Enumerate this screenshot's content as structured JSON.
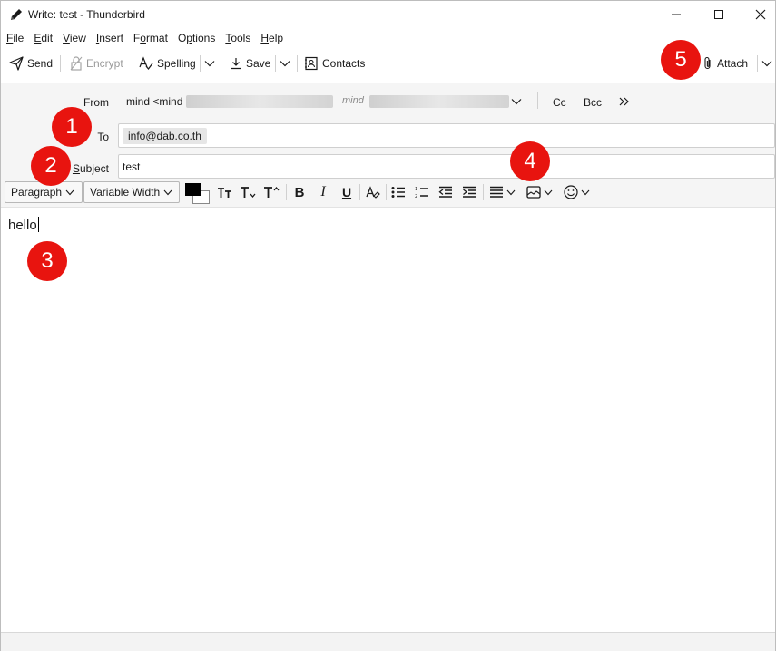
{
  "window": {
    "title": "Write: test - Thunderbird"
  },
  "menu": [
    {
      "key": "F",
      "rest": "ile"
    },
    {
      "key": "E",
      "rest": "dit"
    },
    {
      "key": "V",
      "rest": "iew"
    },
    {
      "key": "I",
      "rest": "nsert"
    },
    {
      "pre": "F",
      "key": "o",
      "rest": "rmat"
    },
    {
      "pre": "O",
      "key": "p",
      "rest": "tions"
    },
    {
      "key": "T",
      "rest": "ools"
    },
    {
      "key": "H",
      "rest": "elp"
    }
  ],
  "toolbar": {
    "send": "Send",
    "encrypt": "Encrypt",
    "spelling": "Spelling",
    "save": "Save",
    "contacts": "Contacts",
    "attach": "Attach"
  },
  "header": {
    "from_label": "From",
    "from_value": "mind <mind",
    "from_identity": "mind",
    "cc": "Cc",
    "bcc": "Bcc",
    "to_label": "To",
    "to_recipient": "info@dab.co.th",
    "subject_label_key": "S",
    "subject_label_rest": "ubject",
    "subject_value": "test"
  },
  "format": {
    "paragraph": "Paragraph",
    "font": "Variable Width"
  },
  "body": {
    "text": "hello"
  },
  "annotations": [
    "1",
    "2",
    "3",
    "4",
    "5"
  ],
  "colors": {
    "badge": "#e8140f",
    "header_bg": "#f5f5f5"
  }
}
